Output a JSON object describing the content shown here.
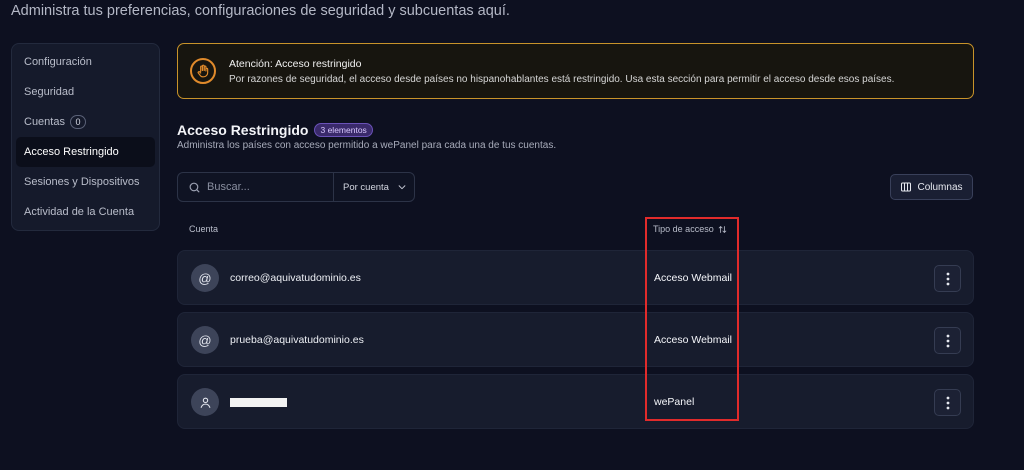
{
  "header": {
    "subtitle": "Administra tus preferencias, configuraciones de seguridad y subcuentas aquí."
  },
  "sidebar": {
    "items": [
      {
        "label": "Configuración"
      },
      {
        "label": "Seguridad"
      },
      {
        "label": "Cuentas",
        "badge": "0"
      },
      {
        "label": "Acceso Restringido",
        "active": true
      },
      {
        "label": "Sesiones y Dispositivos"
      },
      {
        "label": "Actividad de la Cuenta"
      }
    ]
  },
  "alert": {
    "title": "Atención: Acceso restringido",
    "text": "Por razones de seguridad, el acceso desde países no hispanohablantes está restringido. Usa esta sección para permitir el acceso desde esos países.",
    "icon": "hand-stop-icon",
    "color": "#e08a2b"
  },
  "section": {
    "title": "Acceso Restringido",
    "badge": "3 elementos",
    "description": "Administra los países con acceso permitido a wePanel para cada una de tus cuentas."
  },
  "toolbar": {
    "search_placeholder": "Buscar...",
    "filter_label": "Por cuenta",
    "columns_label": "Columnas"
  },
  "table": {
    "headers": {
      "account": "Cuenta",
      "type": "Tipo de acceso"
    },
    "rows": [
      {
        "avatar": "@",
        "account": "correo@aquivatudominio.es",
        "access": "Acceso Webmail"
      },
      {
        "avatar": "@",
        "account": "prueba@aquivatudominio.es",
        "access": "Acceso Webmail"
      },
      {
        "avatar": "user-icon",
        "account": "",
        "access": "wePanel"
      }
    ]
  },
  "colors": {
    "background": "#0d1020",
    "highlight": "#e12b2b",
    "badge": "#6a52b8"
  }
}
